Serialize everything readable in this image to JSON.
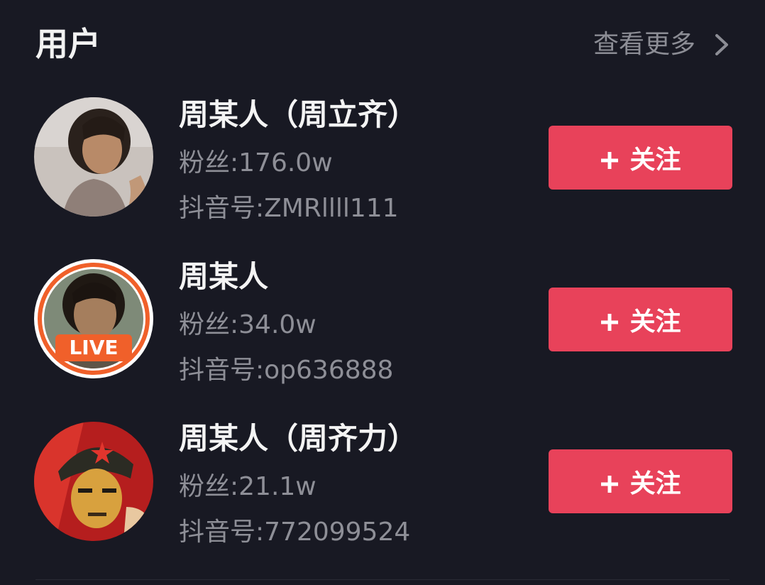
{
  "section": {
    "title": "用户",
    "see_more_label": "查看更多"
  },
  "users": [
    {
      "name": "周某人（周立齐）",
      "fans": "粉丝:176.0w",
      "douyin_id": "抖音号:ZMRllll111",
      "follow_label": "关注",
      "live": false
    },
    {
      "name": "周某人",
      "fans": "粉丝:34.0w",
      "douyin_id": "抖音号:op636888",
      "follow_label": "关注",
      "live": true,
      "live_badge": "LIVE"
    },
    {
      "name": "周某人（周齐力）",
      "fans": "粉丝:21.1w",
      "douyin_id": "抖音号:772099524",
      "follow_label": "关注",
      "live": false
    }
  ],
  "colors": {
    "background": "#181923",
    "follow_button": "#e8425a",
    "live_ring": "#f0602a",
    "name_text": "#f4f4f4",
    "meta_text": "#8e8f97"
  },
  "icons": {
    "see_more": "chevron-right-icon",
    "follow": "plus-icon"
  }
}
